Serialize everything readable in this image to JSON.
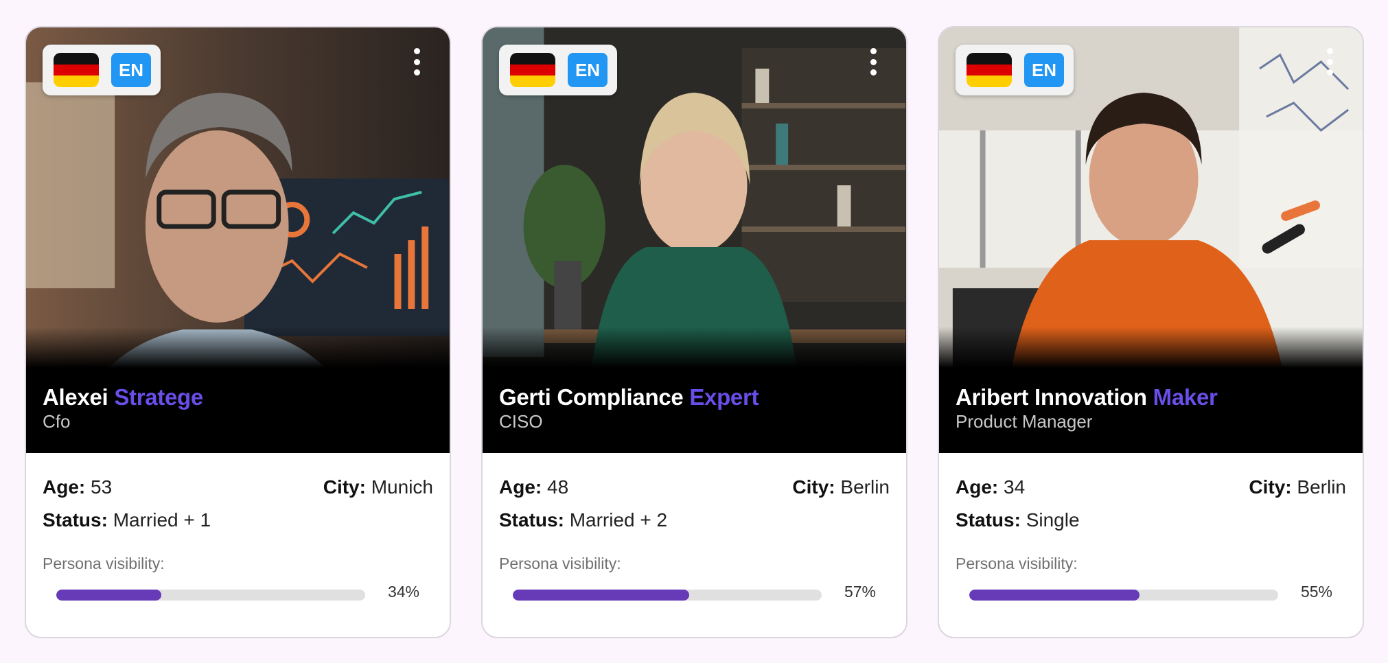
{
  "personas": [
    {
      "first_name": "Alexei",
      "last_name": "Stratege",
      "role": "Cfo",
      "age_label": "Age:",
      "age": "53",
      "city_label": "City:",
      "city": "Munich",
      "status_label": "Status:",
      "status": "Married + 1",
      "visibility_label": "Persona visibility:",
      "visibility_text": "34%",
      "visibility": 0.34,
      "language": "EN",
      "flag": "germany-flag-icon"
    },
    {
      "first_name": "Gerti Compliance",
      "last_name": "Expert",
      "role": "CISO",
      "age_label": "Age:",
      "age": "48",
      "city_label": "City:",
      "city": "Berlin",
      "status_label": "Status:",
      "status": "Married + 2",
      "visibility_label": "Persona visibility:",
      "visibility_text": "57%",
      "visibility": 0.57,
      "language": "EN",
      "flag": "germany-flag-icon"
    },
    {
      "first_name": "Aribert Innovation",
      "last_name": "Maker",
      "role": "Product Manager",
      "age_label": "Age:",
      "age": "34",
      "city_label": "City:",
      "city": "Berlin",
      "status_label": "Status:",
      "status": "Single",
      "visibility_label": "Persona visibility:",
      "visibility_text": "55%",
      "visibility": 0.55,
      "language": "EN",
      "flag": "germany-flag-icon"
    }
  ],
  "colors": {
    "accent_name": "#6a4ee8",
    "progress_fill": "#673ab7",
    "progress_track": "#e0e0e0",
    "language_badge": "#2196f3",
    "page_background": "#fdf5fd"
  },
  "icons": {
    "menu": "more-vert-icon"
  }
}
